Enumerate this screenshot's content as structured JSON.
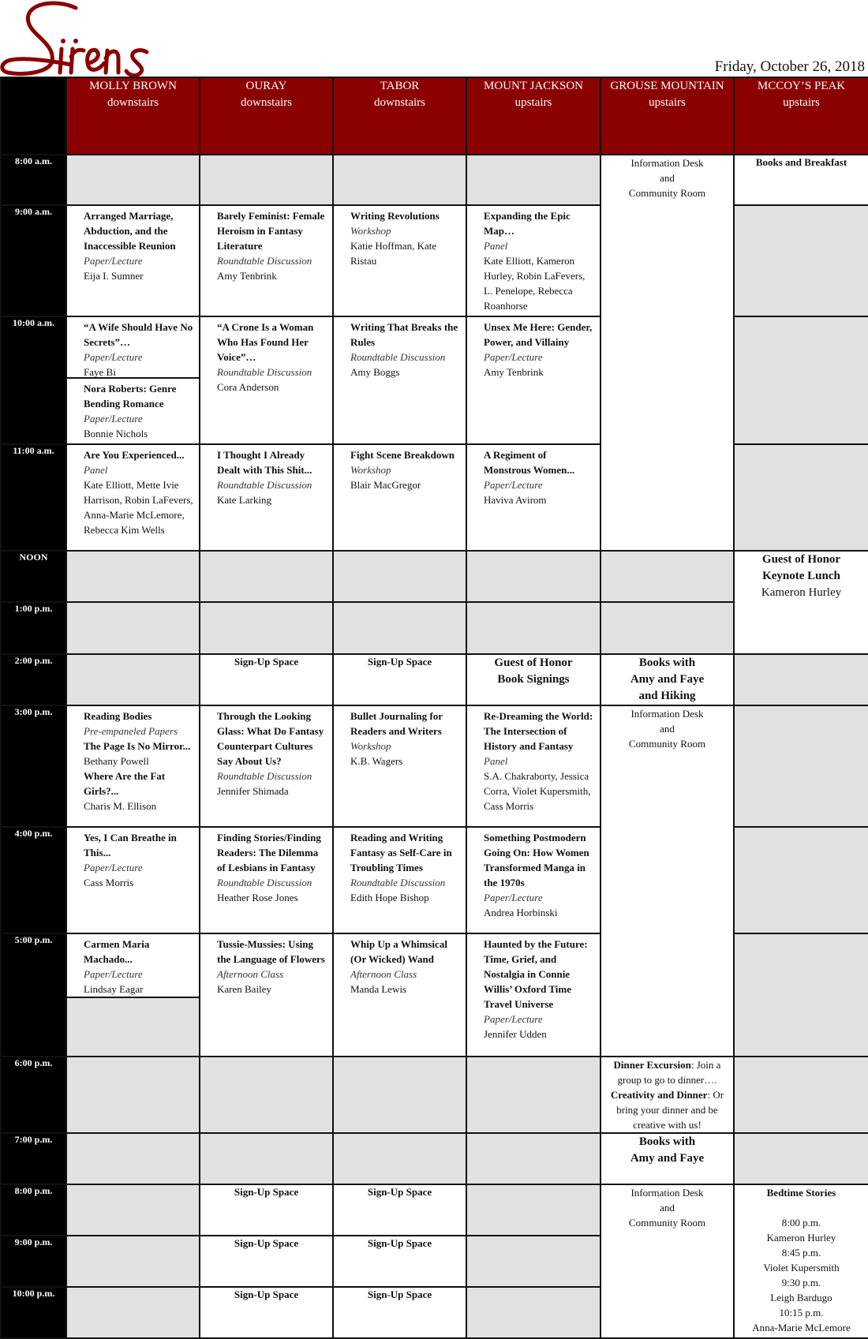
{
  "brand": {
    "logo_text": "Sirens",
    "accent_color": "#8b0000"
  },
  "date": "Friday, October 26, 2018",
  "rooms": [
    {
      "name": "MOLLY BROWN",
      "floor": "downstairs"
    },
    {
      "name": "OURAY",
      "floor": "downstairs"
    },
    {
      "name": "TABOR",
      "floor": "downstairs"
    },
    {
      "name": "MOUNT JACKSON",
      "floor": "upstairs"
    },
    {
      "name": "GROUSE MOUNTAIN",
      "floor": "upstairs"
    },
    {
      "name": "MCCOY’S PEAK",
      "floor": "upstairs"
    }
  ],
  "times": [
    "8:00 a.m.",
    "9:00 a.m.",
    "10:00 a.m.",
    "11:00 a.m.",
    "NOON",
    "1:00 p.m.",
    "2:00 p.m.",
    "3:00 p.m.",
    "4:00 p.m.",
    "5:00 p.m.",
    "6:00 p.m.",
    "7:00 p.m.",
    "8:00 p.m.",
    "9:00 p.m.",
    "10:00 p.m."
  ],
  "sessions": {
    "mb9": {
      "title": "Arranged Marriage, Abduction, and the Inaccessible Reunion",
      "type": "Paper/Lecture",
      "people": "Eija I. Sumner"
    },
    "ou9": {
      "title": "Barely Feminist: Female Heroism in Fantasy Literature",
      "type": "Roundtable Discussion",
      "people": "Amy Tenbrink"
    },
    "ta9": {
      "title": "Writing Revolutions",
      "type": "Workshop",
      "people": "Katie Hoffman, Kate Ristau"
    },
    "mj9": {
      "title": "Expanding the Epic Map…",
      "type": "Panel",
      "people": "Kate Elliott, Kameron Hurley, Robin LaFevers, L. Penelope, Rebecca Roanhorse"
    },
    "mb10a": {
      "title": "“A Wife Should Have No Secrets”…",
      "type": "Paper/Lecture",
      "people": "Faye Bi"
    },
    "mb10b": {
      "title": "Nora Roberts: Genre Bending Romance",
      "type": "Paper/Lecture",
      "people": "Bonnie Nichols"
    },
    "ou10": {
      "title": "“A Crone Is a Woman Who Has Found Her Voice”…",
      "type": "Roundtable Discussion",
      "people": "Cora Anderson"
    },
    "ta10": {
      "title": "Writing That Breaks the Rules",
      "type": "Roundtable Discussion",
      "people": "Amy Boggs"
    },
    "mj10": {
      "title": "Unsex Me Here: Gender, Power, and Villainy",
      "type": "Paper/Lecture",
      "people": "Amy Tenbrink"
    },
    "mb11": {
      "title": "Are You Experienced...",
      "type": "Panel",
      "people": "Kate Elliott, Mette Ivie Harrison, Robin LaFevers, Anna-Marie McLemore, Rebecca Kim Wells"
    },
    "ou11": {
      "title": "I Thought I Already Dealt with This Shit...",
      "type": "Roundtable Discussion",
      "people": "Kate Larking"
    },
    "ta11": {
      "title": "Fight Scene Breakdown",
      "type": "Workshop",
      "people": "Blair MacGregor"
    },
    "mj11": {
      "title": "A Regiment of Monstrous Women...",
      "type": "Paper/Lecture",
      "people": "Haviva Avirom"
    },
    "mb3": {
      "title": "Reading Bodies",
      "type": "Pre-empaneled Papers",
      "paper1_title": "The Page Is No Mirror...",
      "paper1_people": "Bethany Powell",
      "paper2_title": "Where Are the Fat Girls?...",
      "paper2_people": "Charis M. Ellison"
    },
    "ou3": {
      "title": "Through the Looking Glass: What Do Fantasy Counterpart Cultures Say About Us?",
      "type": "Roundtable Discussion",
      "people": "Jennifer Shimada"
    },
    "ta3": {
      "title": "Bullet Journaling for Readers and Writers",
      "type": "Workshop",
      "people": "K.B. Wagers"
    },
    "mj3": {
      "title": "Re-Dreaming the World: The Intersection of History and Fantasy",
      "type": "Panel",
      "people": "S.A. Chakraborty, Jessica Corra, Violet Kupersmith, Cass Morris"
    },
    "mb4": {
      "title": "Yes, I Can Breathe in This...",
      "type": "Paper/Lecture",
      "people": "Cass Morris"
    },
    "ou4": {
      "title": "Finding Stories/Finding Readers: The Dilemma of Lesbians in Fantasy",
      "type": "Roundtable Discussion",
      "people": "Heather Rose Jones"
    },
    "ta4": {
      "title": "Reading and Writing Fantasy as Self-Care in Troubling Times",
      "type": "Roundtable Discussion",
      "people": "Edith Hope Bishop"
    },
    "mj4": {
      "title": "Something Postmodern Going On: How Women Transformed Manga in the 1970s",
      "type": "Paper/Lecture",
      "people": "Andrea Horbinski"
    },
    "mb5": {
      "title": "Carmen Maria Machado...",
      "type": "Paper/Lecture",
      "people": "Lindsay Eagar"
    },
    "ou5": {
      "title": "Tussie-Mussies: Using the Language of Flowers",
      "type": "Afternoon Class",
      "people": "Karen Bailey"
    },
    "ta5": {
      "title": "Whip Up a Whimsical (Or Wicked) Wand",
      "type": "Afternoon Class",
      "people": "Manda Lewis"
    },
    "mj5": {
      "title": "Haunted by the Future: Time, Grief, and Nostalgia in Connie Willis’ Oxford Time Travel Universe",
      "type": "Paper/Lecture",
      "people": "Jennifer Udden"
    }
  },
  "specials": {
    "books_breakfast": "Books and Breakfast",
    "info_line1": "Information Desk",
    "info_line2": "and",
    "info_line3": "Community Room",
    "keynote_line1": "Guest of Honor",
    "keynote_line2": "Keynote Lunch",
    "keynote_person": "Kameron Hurley",
    "signup": "Sign-Up Space",
    "signings_line1": "Guest of Honor",
    "signings_line2": "Book Signings",
    "hiking_line1": "Books with",
    "hiking_line2": "Amy and Faye",
    "hiking_line3": "and Hiking",
    "dinner_excursion_label": "Dinner Excursion",
    "dinner_excursion_text": ": Join a group to go to dinner….",
    "creativity_label": "Creativity and Dinner",
    "creativity_text": ": Or bring your dinner and be creative with us!",
    "books7_line1": "Books with",
    "books7_line2": "Amy and Faye",
    "bedtime_title": "Bedtime Stories",
    "bedtime": [
      {
        "time": "8:00 p.m.",
        "reader": "Kameron Hurley"
      },
      {
        "time": "8:45 p.m.",
        "reader": "Violet Kupersmith"
      },
      {
        "time": "9:30 p.m.",
        "reader": "Leigh Bardugo"
      },
      {
        "time": "10:15 p.m.",
        "reader": "Anna-Marie McLemore"
      }
    ]
  }
}
